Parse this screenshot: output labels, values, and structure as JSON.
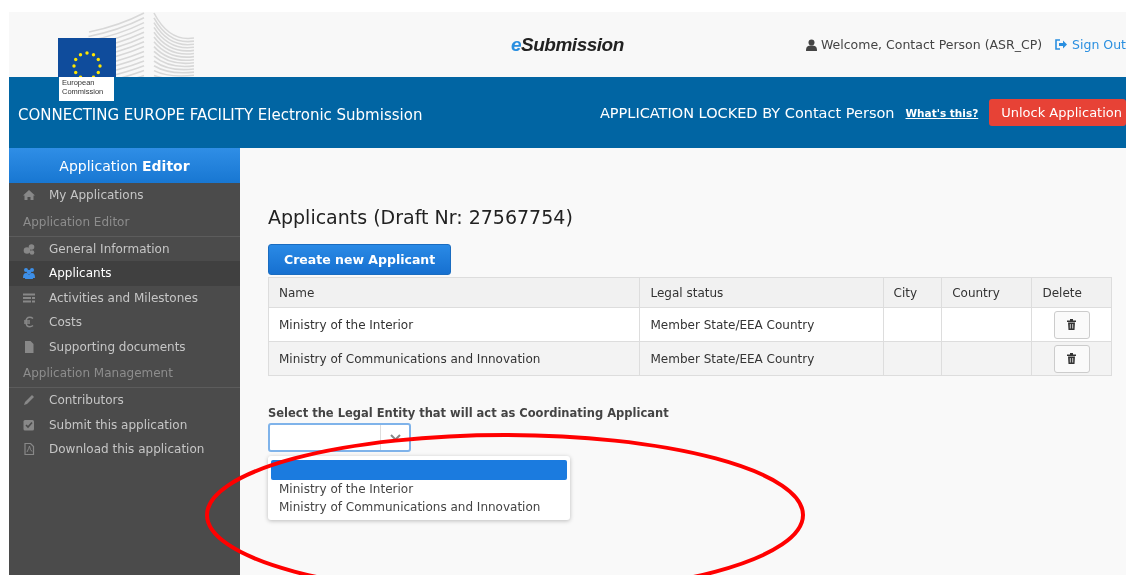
{
  "header": {
    "logo_caption": [
      "European",
      "Commission"
    ],
    "app_name_prefix": "e",
    "app_name_rest": "Submission",
    "welcome": "Welcome, Contact Person (ASR_CP)",
    "sign_out": "Sign Out"
  },
  "banner": {
    "title": "CONNECTING EUROPE FACILITY Electronic Submission",
    "lock_text": "APPLICATION LOCKED BY Contact Person",
    "whats_this": "What's this?",
    "unlock_button": "Unlock Application"
  },
  "sidebar": {
    "title": "Application **Editor**",
    "items": [
      {
        "kind": "link",
        "label": "My Applications",
        "selected": false
      },
      {
        "kind": "heading",
        "label": "Application Editor"
      },
      {
        "kind": "link",
        "label": "General Information",
        "selected": false
      },
      {
        "kind": "link",
        "label": "Applicants",
        "selected": true
      },
      {
        "kind": "link",
        "label": "Activities and Milestones",
        "selected": false
      },
      {
        "kind": "link",
        "label": "Costs",
        "selected": false
      },
      {
        "kind": "link",
        "label": "Supporting documents",
        "selected": false
      },
      {
        "kind": "heading",
        "label": "Application Management"
      },
      {
        "kind": "link",
        "label": "Contributors",
        "selected": false
      },
      {
        "kind": "link",
        "label": "Submit this application",
        "selected": false
      },
      {
        "kind": "link",
        "label": "Download this application",
        "selected": false
      }
    ]
  },
  "main": {
    "heading": "Applicants (Draft Nr: 27567754)",
    "create_button": "Create new Applicant",
    "table": {
      "columns": [
        "Name",
        "Legal status",
        "City",
        "Country",
        "Delete"
      ],
      "rows": [
        {
          "name": "Ministry of the Interior",
          "legal_status": "Member State/EEA Country"
        },
        {
          "name": "Ministry of Communications and Innovation",
          "legal_status": "Member State/EEA Country"
        }
      ]
    },
    "coordinator": {
      "label": "Select the Legal Entity that will act as Coordinating Applicant",
      "open": true,
      "blank_option_highlighted": true,
      "options": [
        {
          "label": "Ministry of the Interior",
          "selected": false
        },
        {
          "label": "Ministry of Communications and Innovation",
          "selected": false
        }
      ]
    },
    "annotation": {
      "kind": "ellipse",
      "color": "#ff0000"
    }
  }
}
